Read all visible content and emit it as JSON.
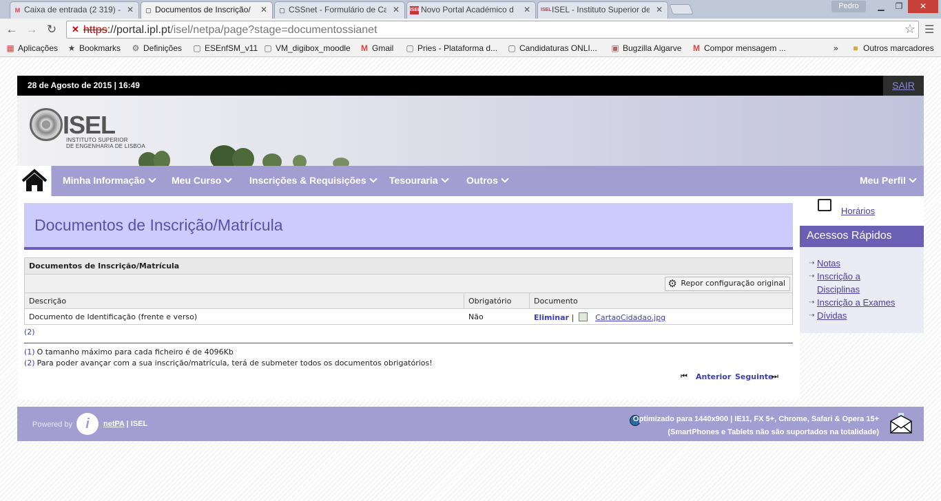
{
  "browser": {
    "tabs": [
      {
        "title": "Caixa de entrada (2 319) -",
        "icon": "gmail-icon",
        "active": false
      },
      {
        "title": "Documentos de Inscrição/",
        "icon": "page-icon",
        "active": true
      },
      {
        "title": "CSSnet - Formulário de Ca",
        "icon": "page-icon",
        "active": false
      },
      {
        "title": "Novo Portal Académico d",
        "icon": "isel-icon",
        "active": false
      },
      {
        "title": "ISEL - Instituto Superior de",
        "icon": "isel-icon",
        "active": false
      }
    ],
    "user": "Pedro",
    "url_scheme": "https",
    "url_host": "://portal.ipl.pt",
    "url_path": "/isel/netpa/page?stage=documentossianet",
    "bookmarks": [
      {
        "label": "Aplicações",
        "icon": "apps-grid-icon"
      },
      {
        "label": "Bookmarks",
        "icon": "star-icon"
      },
      {
        "label": "Definições",
        "icon": "gear-icon"
      },
      {
        "label": "ESEnfSM_v11",
        "icon": "page-icon"
      },
      {
        "label": "VM_digibox_moodle",
        "icon": "page-icon"
      },
      {
        "label": "Gmail",
        "icon": "gmail-icon"
      },
      {
        "label": "Pries - Plataforma d...",
        "icon": "page-icon"
      },
      {
        "label": "Candidaturas ONLI...",
        "icon": "page-icon"
      },
      {
        "label": "Bugzilla Algarve",
        "icon": "bugzilla-icon"
      },
      {
        "label": "Compor mensagem ...",
        "icon": "gmail-icon"
      }
    ],
    "more": "»",
    "other_bookmarks": "Outros marcadores"
  },
  "header": {
    "datetime": "28 de Agosto de 2015 | 16:49",
    "logout": "SAIR"
  },
  "logo": {
    "name": "ISEL",
    "sub1": "INSTITUTO SUPERIOR",
    "sub2": "DE ENGENHARIA DE LISBOA"
  },
  "nav": {
    "items": [
      "Minha Informação",
      "Meu Curso",
      "Inscrições & Requisições",
      "Tesouraria",
      "Outros"
    ],
    "profile": "Meu Perfil"
  },
  "main": {
    "title": "Documentos de Inscrição/Matrícula",
    "panel_title": "Documentos de Inscrição/Matrícula",
    "reset_button": "Repor configuração original",
    "columns": [
      "Descrição",
      "Obrigatório",
      "Documento"
    ],
    "rows": [
      {
        "description": "Documento de Identificação (frente e verso)",
        "required": "Não",
        "action": "Eliminar",
        "separator": "|",
        "file": "CartaoCidadao.jpg"
      }
    ],
    "ref": "(2)",
    "notes": [
      {
        "num": "(1)",
        "text": "O tamanho máximo para cada ficheiro é de 4096Kb"
      },
      {
        "num": "(2)",
        "text": "Para poder avançar com a sua inscrição/matrícula, terá de submeter todos os documentos obrigatórios!"
      }
    ],
    "prev": "Anterior",
    "next": "Seguinte"
  },
  "sidebar": {
    "schedule_link": "Horários",
    "quick_title": "Acessos Rápidos",
    "links": [
      "Notas",
      "Inscrição a",
      "Disciplinas",
      "Inscrição a Exames",
      "Dívidas"
    ]
  },
  "footer": {
    "powered": "Powered by",
    "netpa": "netPA",
    "sep": "| ISEL",
    "opt1": "Optimizado para 1440x900 | IE11, FX 5+, Chrome, Safari & Opera 15+",
    "opt2": "(SmartPhones e Tablets não são suportados na totalidade)"
  },
  "colors": {
    "accent": "#6b5eb5",
    "nav_bg": "#a39ed1",
    "title_bg": "#ccccfc",
    "link": "#3d3db5"
  }
}
